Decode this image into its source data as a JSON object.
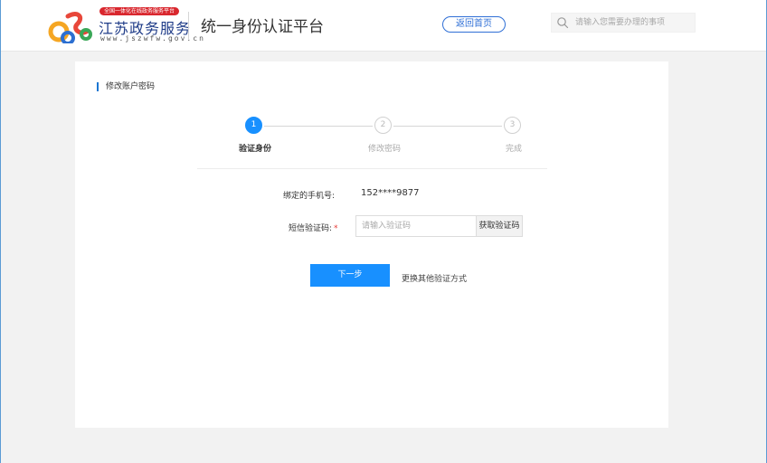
{
  "header": {
    "logo_badge": "全国一体化在线政务服务平台",
    "logo_name": "江苏政务服务",
    "logo_url": "www.jszwfw.gov.cn",
    "platform_title": "统一身份认证平台",
    "home_button": "返回首页",
    "search_placeholder": "请输入您需要办理的事项",
    "colors": {
      "brand_blue": "#1f3c88",
      "accent_blue": "#2f6fd6"
    }
  },
  "main": {
    "section_title": "修改账户密码",
    "steps": [
      {
        "number": "1",
        "label": "验证身份",
        "state": "active"
      },
      {
        "number": "2",
        "label": "修改密码",
        "state": "inactive"
      },
      {
        "number": "3",
        "label": "完成",
        "state": "inactive"
      }
    ],
    "form": {
      "phone_label": "绑定的手机号:",
      "phone_value": "152****9877",
      "code_label": "短信验证码:",
      "code_required_mark": "*",
      "code_placeholder": "请输入验证码",
      "get_code_button": "获取验证码"
    },
    "next_button": "下一步",
    "other_method_link": "更换其他验证方式",
    "colors": {
      "primary": "#1890ff",
      "required": "#e53935"
    }
  }
}
